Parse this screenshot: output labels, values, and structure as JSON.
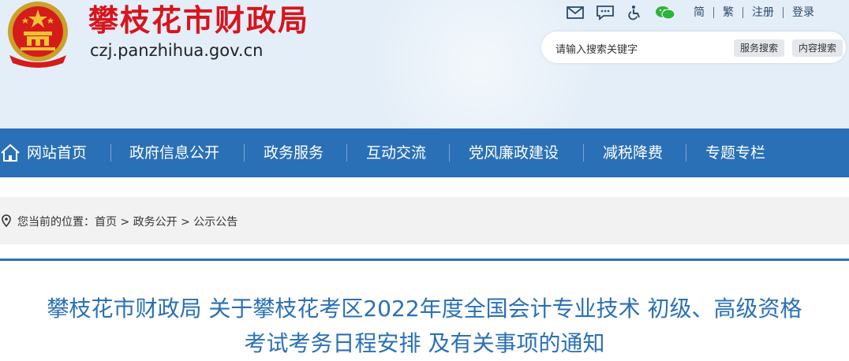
{
  "site": {
    "name": "攀枝花市财政局",
    "domain": "czj.panzhihua.gov.cn"
  },
  "toolbar": {
    "icons": [
      "mail-icon",
      "message-icon",
      "accessibility-icon",
      "wechat-icon"
    ],
    "links": [
      "简",
      "繁",
      "注册",
      "登录"
    ]
  },
  "search": {
    "placeholder": "请输入搜索关键字",
    "service_button": "服务搜索",
    "content_button": "内容搜索"
  },
  "nav": {
    "items": [
      "网站首页",
      "政府信息公开",
      "政务服务",
      "互动交流",
      "党风廉政建设",
      "减税降费",
      "专题专栏"
    ]
  },
  "breadcrumb": {
    "prefix": "您当前的位置：",
    "items": [
      "首页",
      "政务公开",
      "公示公告"
    ],
    "separator": ">"
  },
  "article": {
    "title_line1": "攀枝花市财政局 关于攀枝花考区2022年度全国会计专业技术 初级、高级资格",
    "title_line2": "考试考务日程安排 及有关事项的通知"
  },
  "colors": {
    "brand_red": "#d8141c",
    "nav_blue": "#2a70b6",
    "header_bg": "#e4eef8",
    "title_blue": "#2a70b6"
  }
}
